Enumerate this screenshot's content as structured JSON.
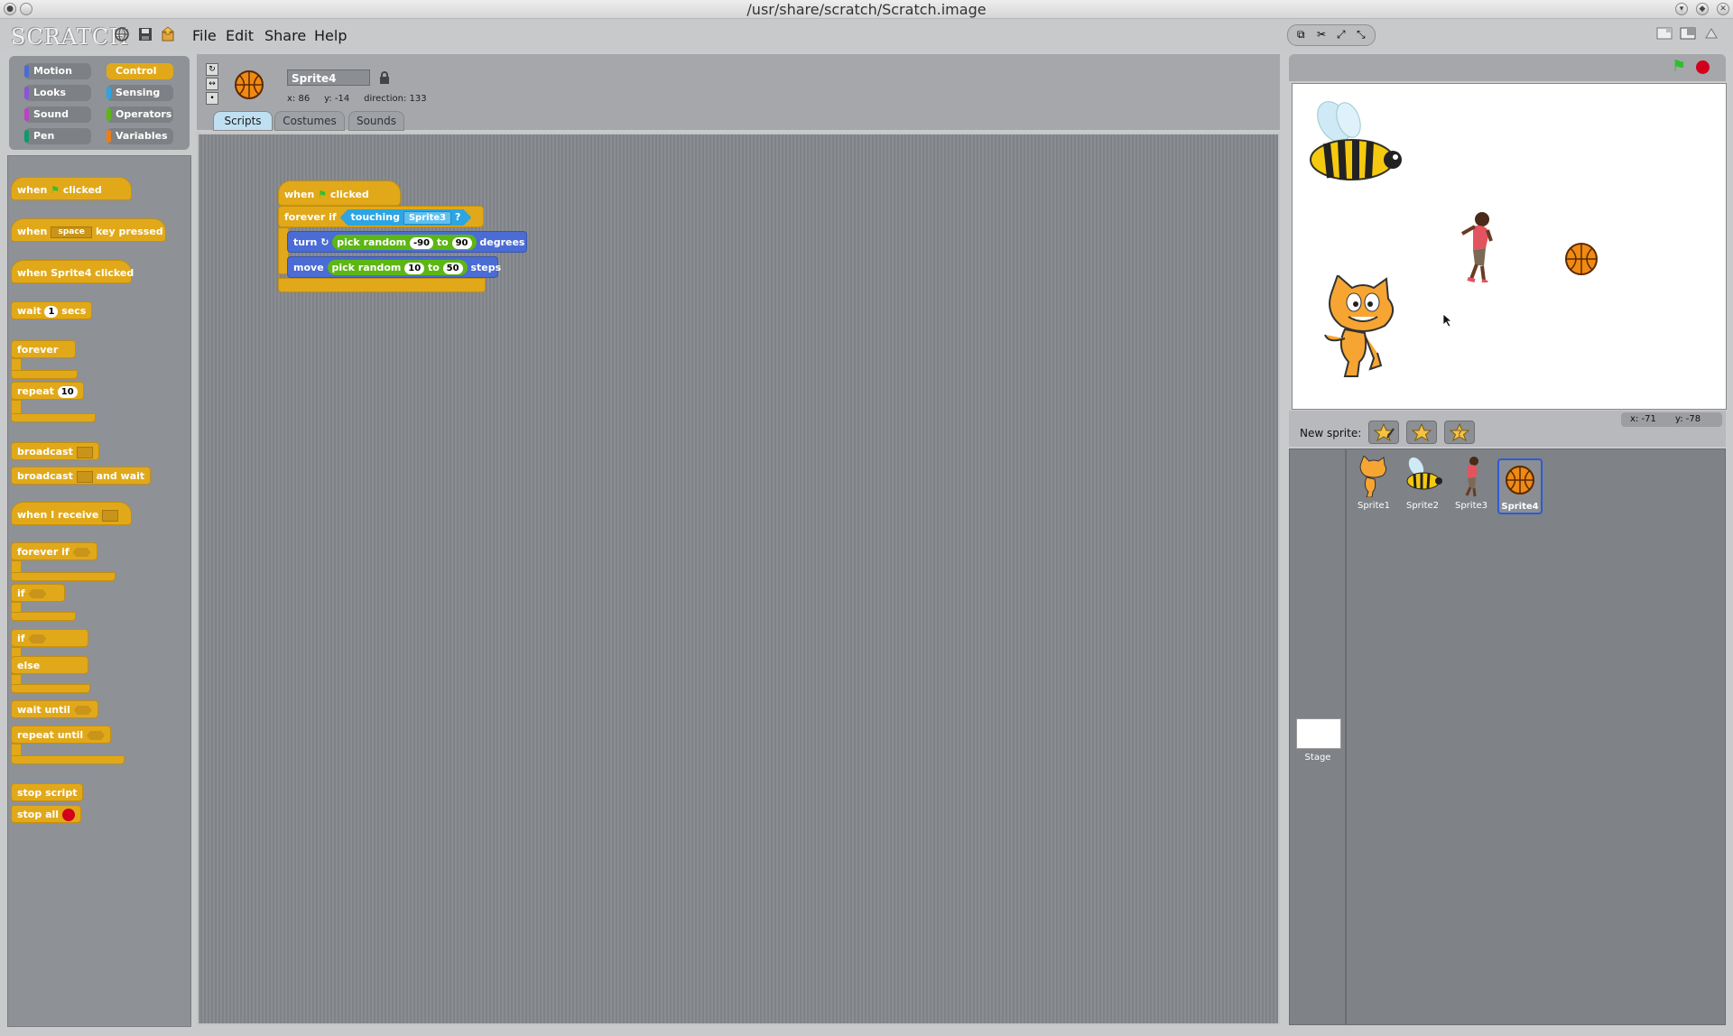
{
  "window": {
    "title": "/usr/share/scratch/Scratch.image"
  },
  "app": {
    "logo": "SCRATCH"
  },
  "menu": {
    "file": "File",
    "edit": "Edit",
    "share": "Share",
    "help": "Help"
  },
  "categories": [
    "Motion",
    "Looks",
    "Sound",
    "Pen",
    "Control",
    "Sensing",
    "Operators",
    "Variables"
  ],
  "category_colors": {
    "Motion": "#4a6cd4",
    "Looks": "#8a55d7",
    "Sound": "#bb42c3",
    "Pen": "#0e9a6c",
    "Control": "#e1a91a",
    "Sensing": "#2ca5e2",
    "Operators": "#5cb712",
    "Variables": "#ee7d16"
  },
  "active_category": "Control",
  "palette": {
    "when_flag": "when",
    "clicked": "clicked",
    "when_key": "when",
    "key_default": "space",
    "key_pressed": "key pressed",
    "when_sprite_clicked": "when Sprite4 clicked",
    "wait": "wait",
    "wait_value": "1",
    "secs": "secs",
    "forever": "forever",
    "repeat": "repeat",
    "repeat_value": "10",
    "broadcast": "broadcast",
    "broadcast_wait": "broadcast",
    "and_wait": "and wait",
    "when_receive": "when I receive",
    "forever_if": "forever if",
    "if1": "if",
    "if2": "if",
    "else": "else",
    "wait_until": "wait until",
    "repeat_until": "repeat until",
    "stop_script": "stop script",
    "stop_all": "stop all"
  },
  "sprite": {
    "name": "Sprite4",
    "x_label": "x:",
    "x": "86",
    "y_label": "y:",
    "y": "-14",
    "direction_label": "direction:",
    "direction": "133"
  },
  "tabs": [
    "Scripts",
    "Costumes",
    "Sounds"
  ],
  "active_tab": "Scripts",
  "script": {
    "hat_when": "when",
    "hat_clicked": "clicked",
    "forever_if": "forever if",
    "touching": "touching",
    "touching_target": "Sprite3",
    "question": "?",
    "turn": "turn",
    "pick_random_1": "pick random",
    "turn_from": "-90",
    "to1": "to",
    "turn_to": "90",
    "degrees": "degrees",
    "move": "move",
    "pick_random_2": "pick random",
    "move_from": "10",
    "to2": "to",
    "move_to": "50",
    "steps": "steps"
  },
  "stage": {
    "mouse_x_label": "x:",
    "mouse_x": "-71",
    "mouse_y_label": "y:",
    "mouse_y": "-78"
  },
  "new_sprite_label": "New sprite:",
  "sprites": [
    "Sprite1",
    "Sprite2",
    "Sprite3",
    "Sprite4"
  ],
  "selected_sprite": "Sprite4",
  "stage_label": "Stage"
}
